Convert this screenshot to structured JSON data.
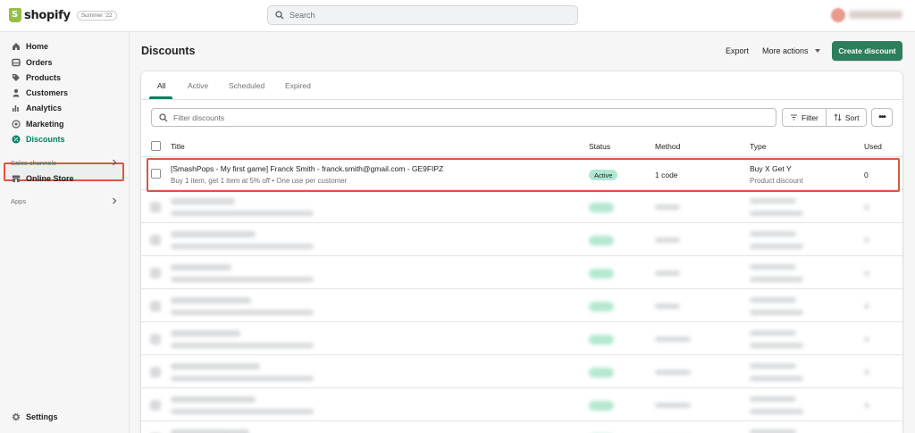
{
  "topbar": {
    "brand": "shopify",
    "edition": "Summer '22",
    "search_placeholder": "Search"
  },
  "sidebar": {
    "items": [
      {
        "label": "Home",
        "icon": "home-icon"
      },
      {
        "label": "Orders",
        "icon": "orders-icon"
      },
      {
        "label": "Products",
        "icon": "tag-icon"
      },
      {
        "label": "Customers",
        "icon": "person-icon"
      },
      {
        "label": "Analytics",
        "icon": "bar-chart-icon"
      },
      {
        "label": "Marketing",
        "icon": "target-icon"
      },
      {
        "label": "Discounts",
        "icon": "discount-icon",
        "active": true
      }
    ],
    "sales_channels_label": "Sales channels",
    "online_store": "Online Store",
    "apps_label": "Apps",
    "settings": "Settings"
  },
  "page": {
    "title": "Discounts",
    "export": "Export",
    "more_actions": "More actions",
    "create_discount": "Create discount"
  },
  "tabs": [
    "All",
    "Active",
    "Scheduled",
    "Expired"
  ],
  "filter": {
    "placeholder": "Filter discounts",
    "filter_label": "Filter",
    "sort_label": "Sort",
    "more": "•••"
  },
  "table": {
    "columns": [
      "Title",
      "Status",
      "Method",
      "Type",
      "Used"
    ],
    "rows": [
      {
        "title": "[SmashPops - My first game] Franck Smith - franck.smith@gmail.com - GE9FIPZ",
        "subtitle": "Buy 1 item, get 1 item at 5% off • One use per customer",
        "status": "Active",
        "method": "1 code",
        "type": "Buy X Get Y",
        "type_sub": "Product discount",
        "used": "0"
      }
    ]
  },
  "colors": {
    "accent": "#008060",
    "primary_button": "#2e7d5c",
    "badge_active": "#aee9d1",
    "highlight": "#d9573e"
  }
}
